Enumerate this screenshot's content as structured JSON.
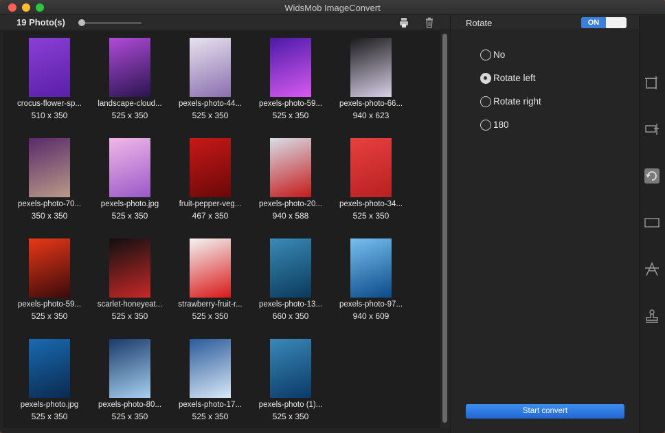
{
  "window": {
    "title": "WidsMob ImageConvert"
  },
  "toolbar": {
    "photo_count": "19 Photo(s)"
  },
  "photos": [
    {
      "name": "crocus-flower-sp...",
      "dims": "510 x 350",
      "colors": [
        "#8a3fd6",
        "#5a1fa8"
      ]
    },
    {
      "name": "landscape-cloud...",
      "dims": "525 x 350",
      "colors": [
        "#b04bd8",
        "#2a1450"
      ]
    },
    {
      "name": "pexels-photo-44...",
      "dims": "525 x 350",
      "colors": [
        "#e8e2ee",
        "#8a6fb0"
      ]
    },
    {
      "name": "pexels-photo-59...",
      "dims": "525 x 350",
      "colors": [
        "#4b1aa8",
        "#d85af0"
      ]
    },
    {
      "name": "pexels-photo-66...",
      "dims": "940 x 623",
      "colors": [
        "#1a1a1a",
        "#d9d0e8"
      ]
    },
    {
      "name": "pexels-photo-70...",
      "dims": "350 x 350",
      "colors": [
        "#5a2a6a",
        "#b89a88"
      ]
    },
    {
      "name": "pexels-photo.jpg",
      "dims": "525 x 350",
      "colors": [
        "#f0b8e8",
        "#9a58c8"
      ]
    },
    {
      "name": "fruit-pepper-veg...",
      "dims": "467 x 350",
      "colors": [
        "#c81818",
        "#6a0808"
      ]
    },
    {
      "name": "pexels-photo-20...",
      "dims": "940 x 588",
      "colors": [
        "#d8dde8",
        "#c41a1a"
      ]
    },
    {
      "name": "pexels-photo-34...",
      "dims": "525 x 350",
      "colors": [
        "#e84040",
        "#b82020"
      ]
    },
    {
      "name": "pexels-photo-59...",
      "dims": "525 x 350",
      "colors": [
        "#e83818",
        "#3a0a0a"
      ]
    },
    {
      "name": "scarlet-honeyeat...",
      "dims": "525 x 350",
      "colors": [
        "#101010",
        "#c82828"
      ]
    },
    {
      "name": "strawberry-fruit-r...",
      "dims": "525 x 350",
      "colors": [
        "#f4f4f4",
        "#d81818"
      ]
    },
    {
      "name": "pexels-photo-13...",
      "dims": "660 x 350",
      "colors": [
        "#3a8ab8",
        "#0a3a5a"
      ]
    },
    {
      "name": "pexels-photo-97...",
      "dims": "940 x 609",
      "colors": [
        "#78c0f0",
        "#0a4a88"
      ]
    },
    {
      "name": "pexels-photo.jpg",
      "dims": "525 x 350",
      "colors": [
        "#1a6ab0",
        "#0a2a50"
      ]
    },
    {
      "name": "pexels-photo-80...",
      "dims": "525 x 350",
      "colors": [
        "#1a3a6a",
        "#a8d0f0"
      ]
    },
    {
      "name": "pexels-photo-17...",
      "dims": "525 x 350",
      "colors": [
        "#2a5a9a",
        "#d8e8f8"
      ]
    },
    {
      "name": "pexels-photo (1)...",
      "dims": "525 x 350",
      "colors": [
        "#3a88b8",
        "#0a3a68"
      ]
    }
  ],
  "panel": {
    "title": "Rotate",
    "toggle_label": "ON",
    "options": [
      {
        "label": "No",
        "checked": false
      },
      {
        "label": "Rotate left",
        "checked": true
      },
      {
        "label": "Rotate right",
        "checked": false
      },
      {
        "label": "180",
        "checked": false
      }
    ],
    "convert_label": "Start convert"
  },
  "sidebar": {
    "icons": [
      "crop-icon",
      "resize-icon",
      "rotate-icon",
      "border-icon",
      "text-watermark-icon",
      "stamp-icon"
    ]
  },
  "colors": {
    "accent": "#3b7fd8",
    "button": "#2f7ae5"
  }
}
